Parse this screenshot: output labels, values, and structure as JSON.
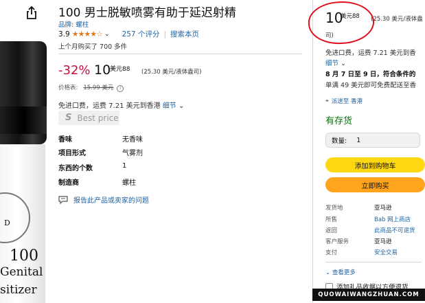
{
  "product": {
    "title": "100 男士脱敏喷雾有助于延迟射精",
    "brand_label": "品牌: 螺柱",
    "rating": "3.9",
    "ratings_count": "257 个评分",
    "search_page": "搜索本页",
    "bought": "上个月购买了 700 多件",
    "bottle_text": [
      "100",
      "Genital",
      "sitizer"
    ],
    "bottle_seal": "D"
  },
  "price": {
    "discount": "-32%",
    "whole": "10",
    "fraction": "88",
    "currency": "美元",
    "unit": "(25.30 美元/液体盎司)",
    "list_label": "价格表:",
    "list_value": "15.99 美元",
    "delivery": "免进口费，运费 7.21 美元到香港",
    "details_link": "细节",
    "best_price": "Best price"
  },
  "specs": [
    {
      "k": "香味",
      "v": "无香味"
    },
    {
      "k": "项目形式",
      "v": "气雾剂"
    },
    {
      "k": "东西的个数",
      "v": "1"
    },
    {
      "k": "制造商",
      "v": "螺柱"
    }
  ],
  "report": "报告此产品或卖家的问题",
  "buybox": {
    "price_whole": "10",
    "price_sup": "美元88",
    "unit_1": "(25.30 美元/液体盎",
    "unit_2": "司)",
    "delivery_1": "免进口费，运费 7.21 美元到香",
    "details": "细节",
    "date_1": "8 月 7 日至 9 日，符合条件的",
    "date_2": "单满 49 美元即可免费配送至香",
    "ship_to": "派送至 香港",
    "stock": "有存货",
    "qty_label": "数量:",
    "qty_value": "1",
    "add_cart": "添加到购物车",
    "buy_now": "立即购买",
    "info": [
      {
        "k": "发货地",
        "v": "亚马逊"
      },
      {
        "k": "所售",
        "v": "Bab 网上商店"
      },
      {
        "k": "返回",
        "v": "此商品不可退货"
      },
      {
        "k": "客户服务",
        "v": "亚马逊"
      },
      {
        "k": "支付",
        "v": "安全交易"
      }
    ],
    "see_more": "查看更多",
    "gift": "添加礼品收据以方便退货",
    "watermark": "QUOWAIWANGZHUAN.COM"
  },
  "colors": {
    "red": "#cc0c39",
    "link": "#2162a1",
    "instock": "#007600",
    "cart": "#ffd814",
    "buy": "#ffa41c",
    "star": "#de7921"
  }
}
